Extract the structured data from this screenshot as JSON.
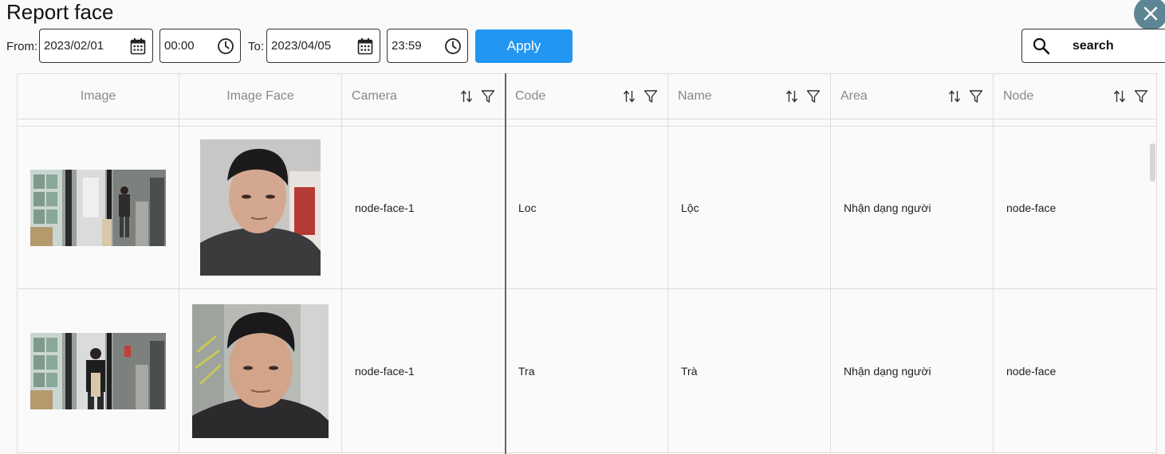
{
  "header": {
    "title": "Report face",
    "close_icon": "close-icon"
  },
  "filters": {
    "from_label": "From:",
    "from_date": "2023/02/01",
    "from_time": "00:00",
    "to_label": "To:",
    "to_date": "2023/04/05",
    "to_time": "23:59",
    "apply_label": "Apply",
    "search_placeholder": "search",
    "accent_color": "#2196f3"
  },
  "table": {
    "columns": [
      "Image",
      "Image Face",
      "Camera",
      "Code",
      "Name",
      "Area",
      "Node"
    ],
    "rows": [
      {
        "camera": "node-face-1",
        "code": "Loc",
        "name": "Lộc",
        "area": "Nhận dạng người",
        "node": "node-face"
      },
      {
        "camera": "node-face-1",
        "code": "Tra",
        "name": "Trà",
        "area": "Nhận dạng người",
        "node": "node-face"
      }
    ]
  }
}
